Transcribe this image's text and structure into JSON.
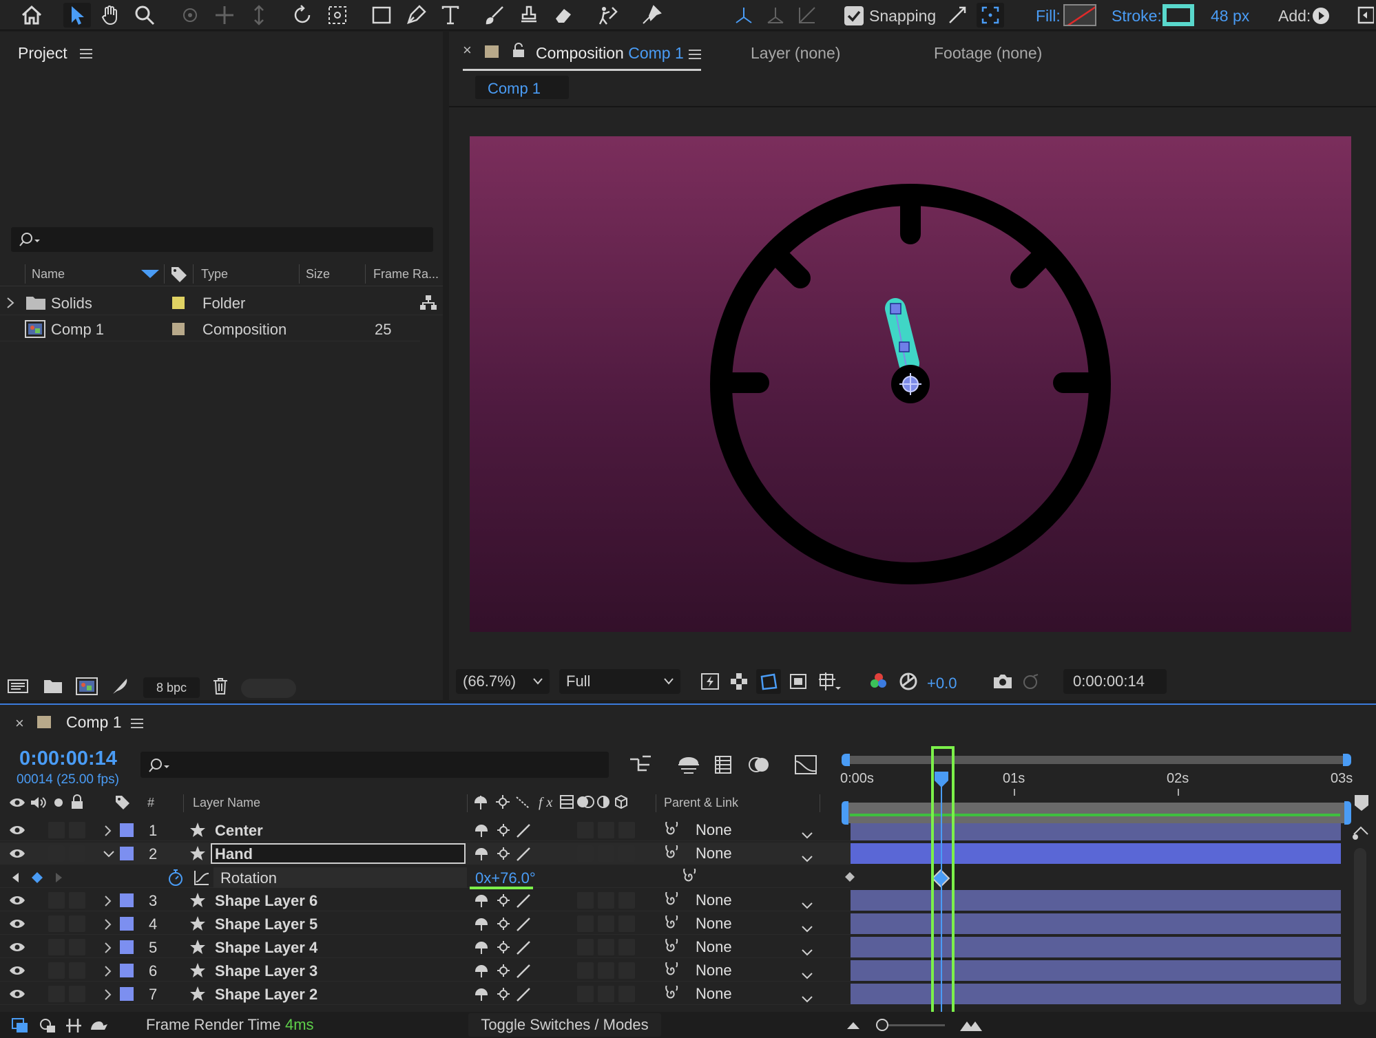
{
  "toolbar": {
    "snapping_label": "Snapping",
    "fill_label": "Fill:",
    "stroke_label": "Stroke:",
    "stroke_width": "48 px",
    "add_label": "Add:",
    "stroke_color": "#59d8cc",
    "fill_color": "none"
  },
  "project": {
    "title": "Project",
    "search_placeholder": "",
    "columns": [
      "Name",
      "Type",
      "Size",
      "Frame Ra..."
    ],
    "items": [
      {
        "name": "Solids",
        "type": "Folder",
        "size": "",
        "frame_rate": "",
        "label_color": "#e0d263"
      },
      {
        "name": "Comp 1",
        "type": "Composition",
        "size": "",
        "frame_rate": "25",
        "label_color": "#b8a98a"
      }
    ],
    "bpc": "8 bpc"
  },
  "viewer": {
    "tab_prefix": "Composition",
    "tab_name": "Comp 1",
    "layer_tab": "Layer (none)",
    "footage_tab": "Footage (none)",
    "breadcrumb": "Comp 1",
    "zoom": "(66.7%)",
    "resolution": "Full",
    "exposure": "+0.0",
    "timecode": "0:00:00:14"
  },
  "timeline": {
    "title": "Comp 1",
    "timecode": "0:00:00:14",
    "frame_info": "00014 (25.00 fps)",
    "col_num": "#",
    "col_layer_name": "Layer Name",
    "col_parent": "Parent & Link",
    "ruler": [
      "0:00s",
      "01s",
      "02s",
      "03s"
    ],
    "layers": [
      {
        "num": "1",
        "name": "Center",
        "parent": "None"
      },
      {
        "num": "2",
        "name": "Hand",
        "parent": "None"
      },
      {
        "num": "3",
        "name": "Shape Layer 6",
        "parent": "None"
      },
      {
        "num": "4",
        "name": "Shape Layer 5",
        "parent": "None"
      },
      {
        "num": "5",
        "name": "Shape Layer 4",
        "parent": "None"
      },
      {
        "num": "6",
        "name": "Shape Layer 3",
        "parent": "None"
      },
      {
        "num": "7",
        "name": "Shape Layer 2",
        "parent": "None"
      }
    ],
    "property_name": "Rotation",
    "property_value": "0x+76.0°",
    "frame_render_label": "Frame Render Time",
    "frame_render_value": "4ms",
    "toggle_label": "Toggle Switches / Modes"
  },
  "colors": {
    "accent": "#4a9cf5",
    "highlight_green": "#7cf04a",
    "layer_bar": "#5a5f9a",
    "hand_color": "#40d6c6"
  }
}
